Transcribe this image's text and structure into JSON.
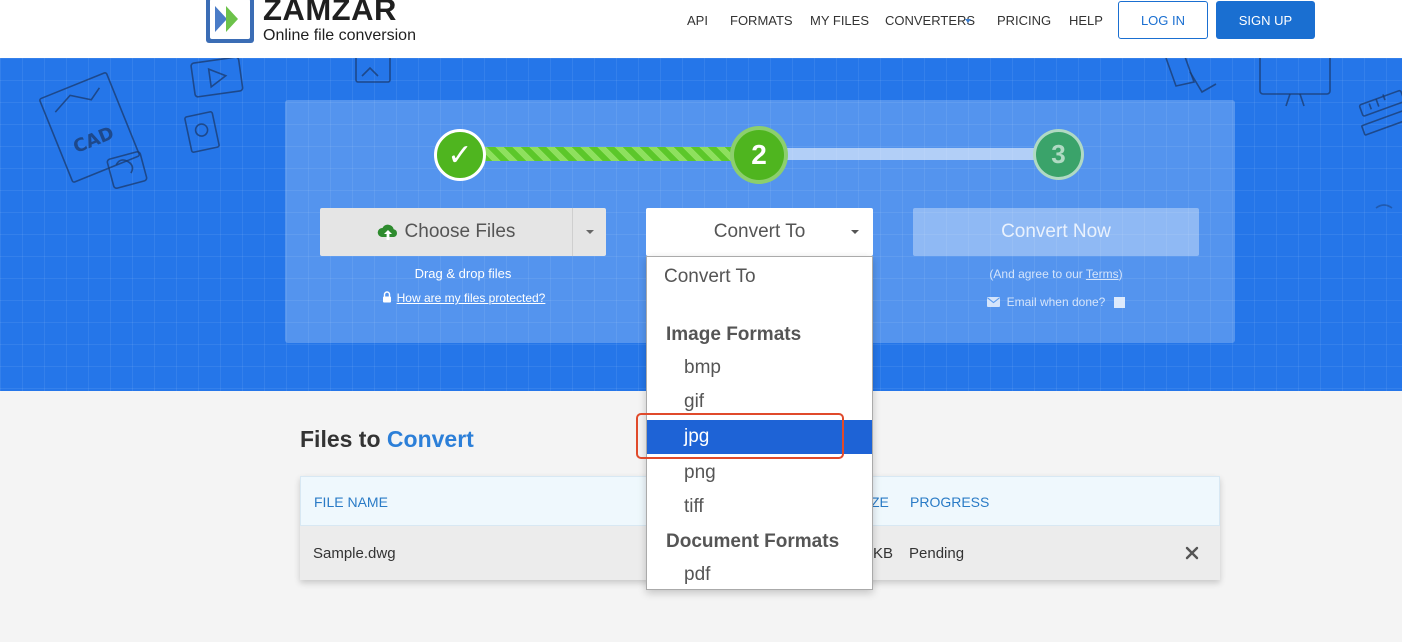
{
  "header": {
    "logo_name": "ZAMZAR",
    "logo_tm": "™",
    "logo_tagline": "Online file conversion",
    "nav": [
      {
        "label": "API"
      },
      {
        "label": "FORMATS"
      },
      {
        "label": "MY FILES"
      },
      {
        "label": "CONVERTERS"
      },
      {
        "label": "PRICING"
      },
      {
        "label": "HELP"
      }
    ],
    "login_label": "LOG IN",
    "signup_label": "SIGN UP"
  },
  "steps": {
    "step1": "✓",
    "step2": "2",
    "step3": "3"
  },
  "choose_files": {
    "label": "Choose Files",
    "drag_text": "Drag & drop files",
    "protect_link": "How are my files protected?"
  },
  "convert_to": {
    "label": "Convert To"
  },
  "convert_now": {
    "label": "Convert Now",
    "agree_prefix": "(And agree to our ",
    "terms_link": "Terms",
    "agree_suffix": ")",
    "email_label": "Email when done?"
  },
  "files_section": {
    "title_prefix": "Files to",
    "title_accent": "Convert",
    "columns": {
      "file_name": "FILE NAME",
      "size_partial": "ZE",
      "progress": "PROGRESS"
    },
    "rows": [
      {
        "file_name": "Sample.dwg",
        "size_partial": "KB",
        "progress": "Pending"
      }
    ]
  },
  "dropdown": {
    "placeholder": "Convert To",
    "groups": [
      {
        "label": "Image Formats",
        "options": [
          "bmp",
          "gif",
          "jpg",
          "png",
          "tiff"
        ]
      },
      {
        "label": "Document Formats",
        "options": [
          "pdf"
        ]
      }
    ],
    "selected": "jpg"
  },
  "colors": {
    "brand_blue": "#1a6fd1",
    "hero_blue": "#2576e9",
    "step_green": "#4fb51f",
    "selected_option": "#1e63d6",
    "highlight_red": "#e04a2b"
  }
}
